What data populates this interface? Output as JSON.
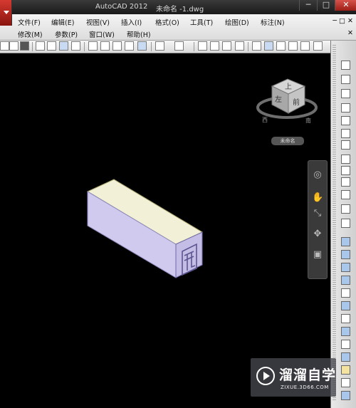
{
  "title_bar": {
    "app_title": "AutoCAD 2012",
    "doc_title": "未命名 -1.dwg"
  },
  "window_controls": {
    "minimize": "─",
    "maximize": "□",
    "close": "✕"
  },
  "menu": {
    "row1": [
      "文件(F)",
      "编辑(E)",
      "视图(V)",
      "插入(I)",
      "格式(O)",
      "工具(T)",
      "绘图(D)",
      "标注(N)"
    ],
    "row2": [
      "修改(M)",
      "参数(P)",
      "窗口(W)",
      "帮助(H)"
    ],
    "row1_ctrl": "─ □ ✕",
    "row2_ctrl": "✕"
  },
  "viewcube": {
    "label": "未命名",
    "face_top": "上",
    "face_front": "前",
    "face_left": "左",
    "compass_west": "西",
    "compass_south": "南"
  },
  "watermark": {
    "brand": "溜溜自学",
    "url": "ZIXUE.3D66.COM"
  },
  "colors": {
    "box_side": "#d0cbee",
    "box_top": "#f3f0d8",
    "box_end": "#c4bde6",
    "viewport_bg": "#000000"
  }
}
